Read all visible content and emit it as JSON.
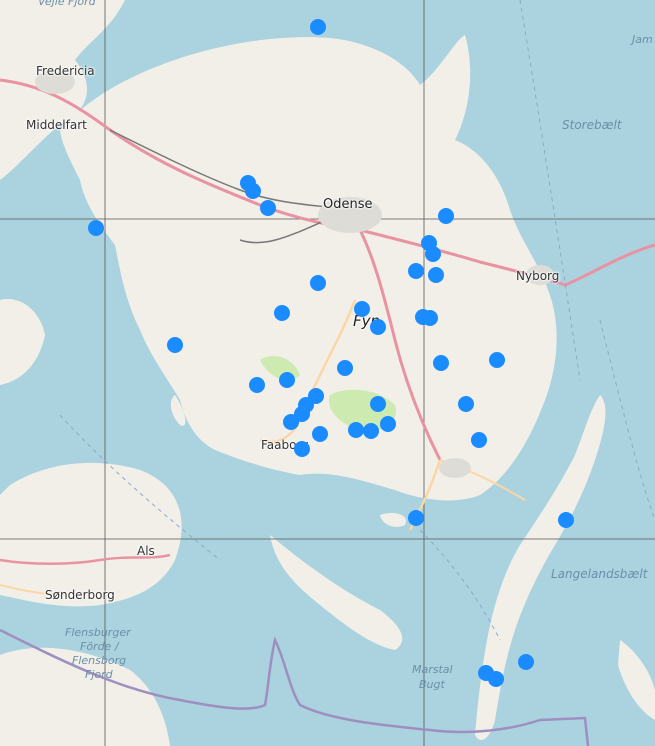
{
  "labels": {
    "odense": "Odense",
    "fredericia": "Fredericia",
    "middelfart": "Middelfart",
    "nyborg": "Nyborg",
    "faaborg": "Faaborg",
    "fyn": "Fyn",
    "als": "Als",
    "sonderborg": "Sønderborg",
    "storebaelt": "Storebælt",
    "langelandsbaelt": "Langelandsbælt",
    "flensburger_1": "Flensburger",
    "flensburger_2": "Förde /",
    "flensburger_3": "Flensborg",
    "flensburger_4": "Fjord",
    "marstal_1": "Marstal",
    "marstal_2": "Bugt",
    "vejle_fjord": "Vejle Fjord",
    "jam": "Jam"
  },
  "colors": {
    "water": "#aad3df",
    "land": "#f2efe9",
    "park": "#cdebb0",
    "motorway": "#e892a2",
    "primary": "#fcd6a4",
    "border": "#9e8fc0",
    "marker": "#1a8cff"
  },
  "marker_count": 40
}
